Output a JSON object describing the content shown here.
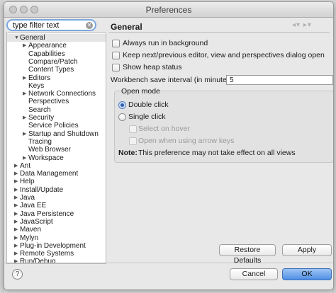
{
  "window": {
    "title": "Preferences"
  },
  "search": {
    "value": "type filter text"
  },
  "tree": [
    {
      "label": "General",
      "expanded": true,
      "level": 0,
      "selected": true
    },
    {
      "label": "Appearance",
      "expander": true,
      "level": 1
    },
    {
      "label": "Capabilities",
      "level": 1
    },
    {
      "label": "Compare/Patch",
      "level": 1
    },
    {
      "label": "Content Types",
      "level": 1
    },
    {
      "label": "Editors",
      "expander": true,
      "level": 1
    },
    {
      "label": "Keys",
      "level": 1
    },
    {
      "label": "Network Connections",
      "expander": true,
      "level": 1
    },
    {
      "label": "Perspectives",
      "level": 1
    },
    {
      "label": "Search",
      "level": 1
    },
    {
      "label": "Security",
      "expander": true,
      "level": 1
    },
    {
      "label": "Service Policies",
      "level": 1
    },
    {
      "label": "Startup and Shutdown",
      "expander": true,
      "level": 1
    },
    {
      "label": "Tracing",
      "level": 1
    },
    {
      "label": "Web Browser",
      "level": 1
    },
    {
      "label": "Workspace",
      "expander": true,
      "level": 1
    },
    {
      "label": "Ant",
      "expander": true,
      "level": 0
    },
    {
      "label": "Data Management",
      "expander": true,
      "level": 0
    },
    {
      "label": "Help",
      "expander": true,
      "level": 0
    },
    {
      "label": "Install/Update",
      "expander": true,
      "level": 0
    },
    {
      "label": "Java",
      "expander": true,
      "level": 0
    },
    {
      "label": "Java EE",
      "expander": true,
      "level": 0
    },
    {
      "label": "Java Persistence",
      "expander": true,
      "level": 0
    },
    {
      "label": "JavaScript",
      "expander": true,
      "level": 0
    },
    {
      "label": "Maven",
      "expander": true,
      "level": 0
    },
    {
      "label": "Mylyn",
      "expander": true,
      "level": 0
    },
    {
      "label": "Plug-in Development",
      "expander": true,
      "level": 0
    },
    {
      "label": "Remote Systems",
      "expander": true,
      "level": 0
    },
    {
      "label": "Run/Debug",
      "expander": true,
      "level": 0
    }
  ],
  "panel": {
    "title": "General",
    "options": {
      "always_run": "Always run in background",
      "keep_next": "Keep next/previous editor, view and perspectives dialog open",
      "show_heap": "Show heap status"
    },
    "save_interval_label": "Workbench save interval (in minutes):",
    "save_interval_value": "5",
    "open_mode": {
      "title": "Open mode",
      "double_click": "Double click",
      "single_click": "Single click",
      "select_on_hover": "Select on hover",
      "open_arrow_keys": "Open when using arrow keys",
      "note_label": "Note:",
      "note_text": "This preference may not take effect on all views"
    }
  },
  "buttons": {
    "restore_defaults": "Restore Defaults",
    "apply": "Apply",
    "cancel": "Cancel",
    "ok": "OK",
    "help": "?"
  }
}
